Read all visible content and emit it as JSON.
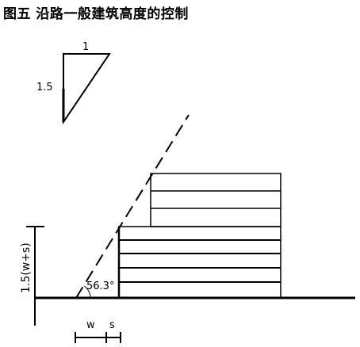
{
  "title": "图五  沿路一般建筑高度的控制",
  "slope_symbol": {
    "run_label": "1",
    "rise_label": "1.5"
  },
  "angle_label": "56.3°",
  "height_dimension_label": "1.5(w+s)",
  "width_label": "w",
  "setback_label": "s"
}
